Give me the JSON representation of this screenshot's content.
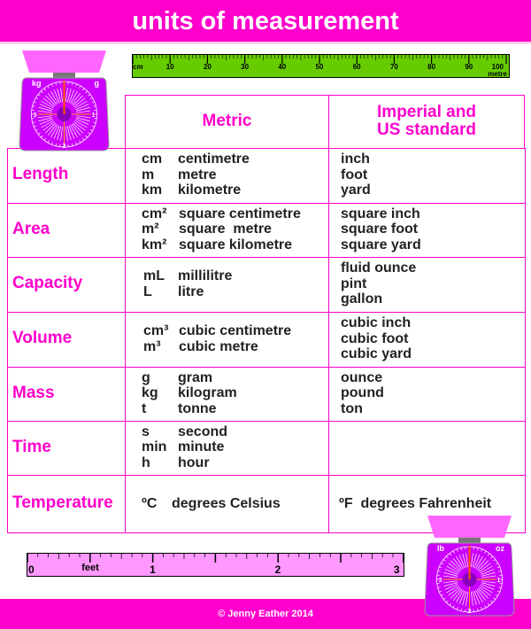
{
  "title": "units of measurement",
  "footer": "© Jenny Eather 2014",
  "colors": {
    "accent": "#ff00cc",
    "ruler_metric": "#66cc00",
    "ruler_feet": "#ff99ff",
    "scale_body": "#cc00ff"
  },
  "metre_ruler": {
    "start_label": "cm",
    "end_label": "metre",
    "ticks": [
      "10",
      "20",
      "30",
      "40",
      "50",
      "60",
      "70",
      "80",
      "90",
      "100"
    ]
  },
  "feet_ruler": {
    "unit_label": "feet",
    "ticks": [
      "0",
      "1",
      "2",
      "3"
    ]
  },
  "scale_top": {
    "left_label": "kg",
    "right_label": "g",
    "dial": [
      "1",
      "2",
      "3"
    ]
  },
  "scale_bottom": {
    "left_label": "lb",
    "right_label": "oz",
    "dial": [
      "1",
      "2",
      "3"
    ]
  },
  "table": {
    "headers": [
      "Metric",
      "Imperial and\nUS standard"
    ],
    "rows": [
      {
        "label": "Length",
        "metric": [
          [
            "cm",
            "centimetre"
          ],
          [
            "m",
            "metre"
          ],
          [
            "km",
            "kilometre"
          ]
        ],
        "imperial": [
          "inch",
          "foot",
          "yard"
        ]
      },
      {
        "label": "Area",
        "metric": [
          [
            "cm²",
            "square centimetre"
          ],
          [
            "m²",
            "square  metre"
          ],
          [
            "km²",
            "square kilometre"
          ]
        ],
        "imperial": [
          "square inch",
          "square foot",
          "square yard"
        ]
      },
      {
        "label": "Capacity",
        "metric": [
          [
            "mL",
            "millilitre"
          ],
          [
            "L",
            "litre"
          ]
        ],
        "imperial": [
          "fluid ounce",
          "pint",
          "gallon"
        ]
      },
      {
        "label": "Volume",
        "metric": [
          [
            "cm³",
            "cubic centimetre"
          ],
          [
            "m³",
            "cubic metre"
          ]
        ],
        "imperial": [
          "cubic inch",
          "cubic foot",
          "cubic yard"
        ]
      },
      {
        "label": "Mass",
        "metric": [
          [
            "g",
            "gram"
          ],
          [
            "kg",
            "kilogram"
          ],
          [
            "t",
            "tonne"
          ]
        ],
        "imperial": [
          "ounce",
          "pound",
          "ton"
        ]
      },
      {
        "label": "Time",
        "metric": [
          [
            "s",
            "second"
          ],
          [
            "min",
            "minute"
          ],
          [
            "h",
            "hour"
          ]
        ],
        "imperial": []
      },
      {
        "label": "Temperature",
        "metric": [
          [
            "ºC",
            "degrees Celsius"
          ]
        ],
        "imperial": [
          "ºF  degrees Fahrenheit"
        ]
      }
    ]
  }
}
